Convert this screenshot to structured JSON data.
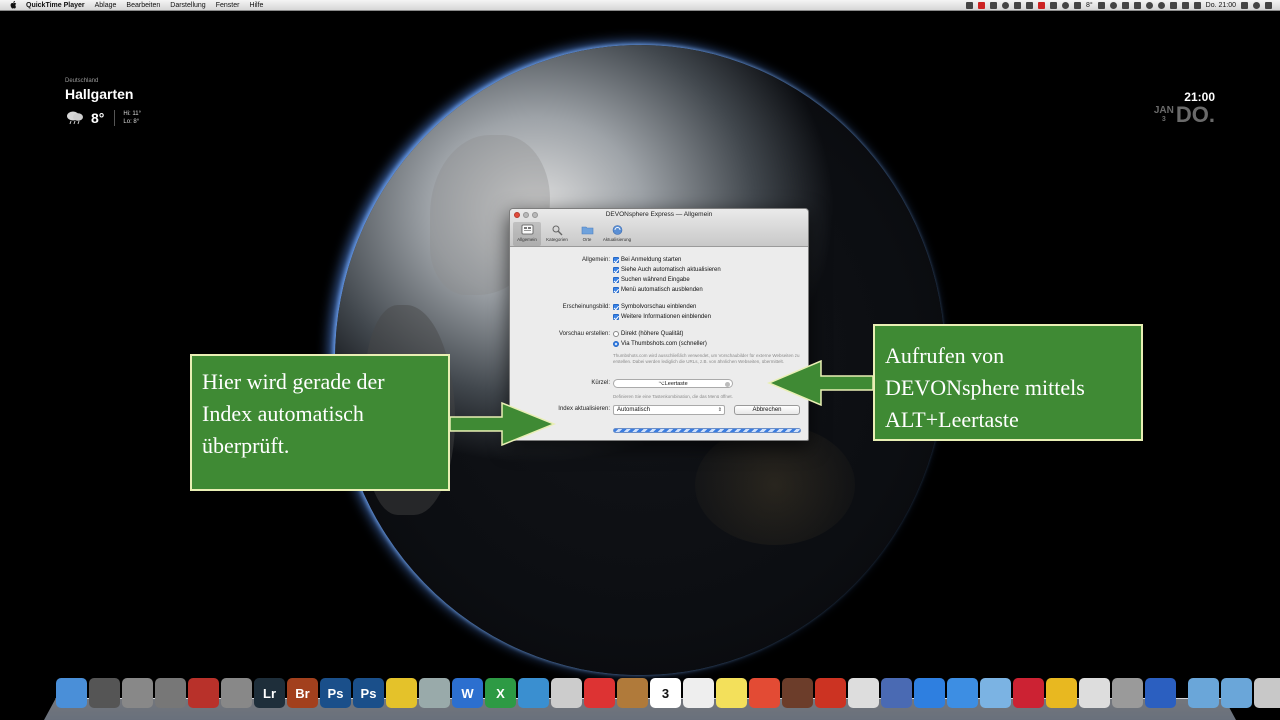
{
  "menubar": {
    "app": "QuickTime Player",
    "items": [
      "Ablage",
      "Bearbeiten",
      "Darstellung",
      "Fenster",
      "Hilfe"
    ],
    "temperature": "8°",
    "clock": "Do. 21:00"
  },
  "weather": {
    "country": "Deutschland",
    "city": "Hallgarten",
    "temperature": "8°",
    "hi": "Hi: 11°",
    "lo": "Lo: 8°",
    "icon": "rain-cloud-icon"
  },
  "clock_widget": {
    "time": "21:00",
    "month": "JAN",
    "day": "3",
    "weekday": "DO."
  },
  "window": {
    "title": "DEVONsphere Express — Allgemein",
    "toolbar": [
      {
        "label": "Allgemein",
        "icon": "general-icon",
        "active": true
      },
      {
        "label": "Kategorien",
        "icon": "categories-icon",
        "active": false
      },
      {
        "label": "Orte",
        "icon": "folder-icon",
        "active": false
      },
      {
        "label": "Aktualisierung",
        "icon": "update-icon",
        "active": false
      }
    ],
    "general": {
      "label": "Allgemein:",
      "options": [
        "Bei Anmeldung starten",
        "Siehe Auch automatisch aktualisieren",
        "Suchen während Eingabe",
        "Menü automatisch ausblenden"
      ]
    },
    "appearance": {
      "label": "Erscheinungsbild:",
      "options": [
        "Symbolvorschau einblenden",
        "Weitere Informationen einblenden"
      ]
    },
    "preview": {
      "label": "Vorschau erstellen:",
      "options": [
        "Direkt (höhere Qualität)",
        "Via Thumbshots.com (schneller)"
      ],
      "hint": "Thumbshots.com wird ausschließlich verwendet, um Vorschaubilder für externe Webseiten zu erstellen. Dabei werden lediglich die URLs, z.B. von ähnlichen Webseiten, übermittelt."
    },
    "shortcut": {
      "label": "Kürzel:",
      "value": "⌥Leertaste",
      "hint": "Definieren Sie eine Tastenkombination, die das Menü öffnet."
    },
    "index": {
      "label": "Index aktualisieren:",
      "value": "Automatisch",
      "cancel": "Abbrechen"
    }
  },
  "callouts": {
    "left": "Hier wird gerade der Index automatisch überprüft.",
    "right": "Aufrufen von DEVONsphere mittels ALT+Leertaste"
  },
  "dock": {
    "icons": [
      {
        "name": "finder-icon",
        "color": "#4a8fd8"
      },
      {
        "name": "dashboard-icon",
        "color": "#555"
      },
      {
        "name": "launchpad-icon",
        "color": "#888"
      },
      {
        "name": "photo-app-icon",
        "color": "#777"
      },
      {
        "name": "presentation-icon",
        "color": "#b8312a"
      },
      {
        "name": "preview-icon",
        "color": "#888"
      },
      {
        "name": "lightroom-icon",
        "text": "Lr",
        "color": "#1e2e3a"
      },
      {
        "name": "bridge-icon",
        "text": "Br",
        "color": "#a2401d"
      },
      {
        "name": "photoshop-icon",
        "text": "Ps",
        "color": "#1a4f8a"
      },
      {
        "name": "photoshop-32-icon",
        "text": "Ps",
        "color": "#1a4f8a"
      },
      {
        "name": "macmeteshow-icon",
        "color": "#e4c22a"
      },
      {
        "name": "imageutil-icon",
        "color": "#9aa"
      },
      {
        "name": "word-icon",
        "text": "W",
        "color": "#2c6fcf"
      },
      {
        "name": "excel-icon",
        "text": "X",
        "color": "#2d9a44"
      },
      {
        "name": "vortex-icon",
        "color": "#3a8fd0"
      },
      {
        "name": "pdf-tool-icon",
        "color": "#ccc"
      },
      {
        "name": "pdf-icon",
        "color": "#d33"
      },
      {
        "name": "notes-box-icon",
        "color": "#b07a3a"
      },
      {
        "name": "calendar-icon",
        "text": "3",
        "color": "#fff"
      },
      {
        "name": "textedit-icon",
        "color": "#eee"
      },
      {
        "name": "stickies-icon",
        "color": "#f3e05b"
      },
      {
        "name": "chrome-icon",
        "color": "#e34b34"
      },
      {
        "name": "books-icon",
        "color": "#6c3d2a"
      },
      {
        "name": "book-red-icon",
        "color": "#c32"
      },
      {
        "name": "calendar-grid-icon",
        "color": "#ddd"
      },
      {
        "name": "pen-tool-icon",
        "color": "#4a6ab3"
      },
      {
        "name": "appstore-icon",
        "color": "#2e7fe0"
      },
      {
        "name": "itunes-icon",
        "color": "#3d8ee3"
      },
      {
        "name": "monitor-icon",
        "color": "#7bb3e3"
      },
      {
        "name": "dictionary-icon",
        "color": "#c23"
      },
      {
        "name": "wlan-icon",
        "color": "#e8b820"
      },
      {
        "name": "document-icon",
        "color": "#ddd"
      },
      {
        "name": "printer-icon",
        "color": "#9a9a9a"
      },
      {
        "name": "network-icon",
        "color": "#2b5fc0"
      },
      {
        "name": "folder-documents-icon",
        "color": "#6aa6d9"
      },
      {
        "name": "folder-downloads-icon",
        "color": "#6aa6d9"
      },
      {
        "name": "trash-icon",
        "color": "#c8c8c8"
      }
    ]
  }
}
